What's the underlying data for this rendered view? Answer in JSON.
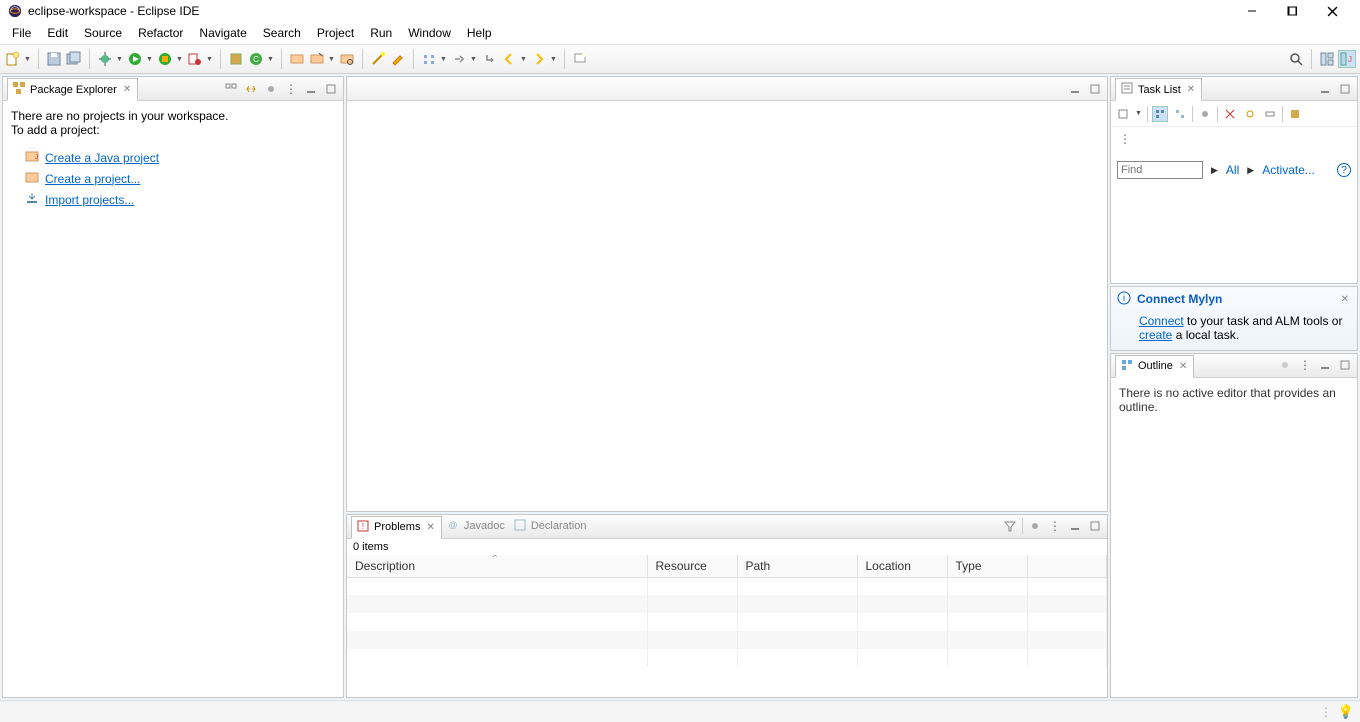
{
  "window": {
    "title": "eclipse-workspace - Eclipse IDE"
  },
  "menu": {
    "items": [
      "File",
      "Edit",
      "Source",
      "Refactor",
      "Navigate",
      "Search",
      "Project",
      "Run",
      "Window",
      "Help"
    ]
  },
  "packageExplorer": {
    "title": "Package Explorer",
    "msg1": "There are no projects in your workspace.",
    "msg2": "To add a project:",
    "links": {
      "createJava": "Create a Java project",
      "createProject": "Create a project...",
      "importProjects": "Import projects..."
    }
  },
  "taskList": {
    "title": "Task List",
    "findPlaceholder": "Find",
    "all": "All",
    "activate": "Activate..."
  },
  "mylyn": {
    "title": "Connect Mylyn",
    "connect": "Connect",
    "text1": " to your task and ALM tools or ",
    "create": "create",
    "text2": " a local task."
  },
  "outline": {
    "title": "Outline",
    "msg": "There is no active editor that provides an outline."
  },
  "bottom": {
    "tabs": {
      "problems": "Problems",
      "javadoc": "Javadoc",
      "declaration": "Declaration"
    },
    "items": "0 items",
    "columns": {
      "description": "Description",
      "resource": "Resource",
      "path": "Path",
      "location": "Location",
      "type": "Type"
    }
  }
}
